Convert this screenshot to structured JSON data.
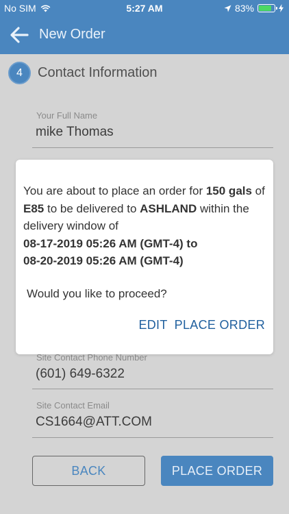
{
  "status_bar": {
    "carrier": "No SIM",
    "time": "5:27 AM",
    "battery_percent": "83%",
    "battery_level": 0.83
  },
  "header": {
    "title": "New Order",
    "back_icon": "arrow-left-icon"
  },
  "section": {
    "step_number": "4",
    "title": "Contact Information"
  },
  "fields": {
    "full_name": {
      "label": "Your Full Name",
      "value": "mike Thomas"
    },
    "site_phone": {
      "label": "Site Contact Phone Number",
      "value": "(601) 649-6322"
    },
    "site_email": {
      "label": "Site Contact Email",
      "value": "CS1664@ATT.COM"
    }
  },
  "dialog": {
    "text_1": "You are about to place an order for ",
    "quantity": "150 gals",
    "text_2": " of ",
    "product": "E85",
    "text_3": " to be delivered to ",
    "location": "ASHLAND",
    "text_4": " within the delivery window of ",
    "window_start": "08-17-2019 05:26 AM (GMT-4) to",
    "window_end": "08-20-2019 05:26 AM (GMT-4)",
    "question": "Would you like to proceed?",
    "edit_label": "EDIT",
    "place_order_label": "PLACE ORDER"
  },
  "buttons": {
    "back_label": "BACK",
    "place_order_label": "PLACE ORDER"
  },
  "colors": {
    "primary": "#4a86bf",
    "overlay_background": "#d4d4d4",
    "dialog_action": "#1f5f9e",
    "battery": "#4cd964"
  }
}
